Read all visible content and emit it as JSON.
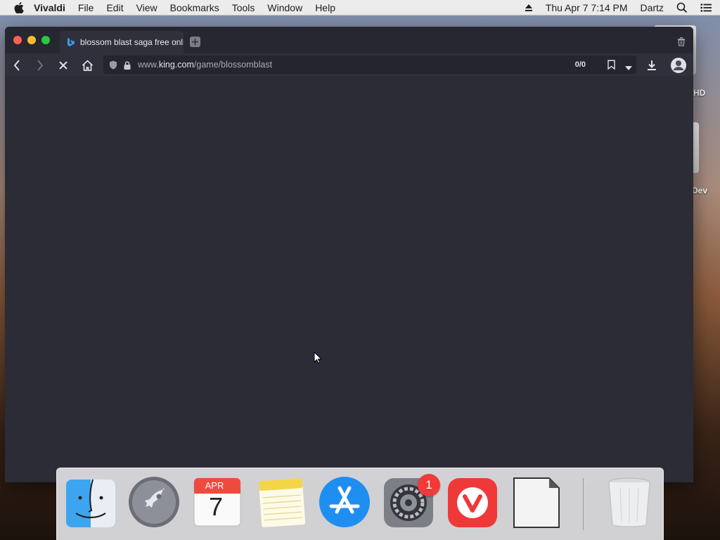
{
  "menubar": {
    "app_name": "Vivaldi",
    "menus": [
      "File",
      "Edit",
      "View",
      "Bookmarks",
      "Tools",
      "Window",
      "Help"
    ],
    "datetime": "Thu Apr 7  7:14 PM",
    "user": "Dartz"
  },
  "desktop": {
    "disk_label": "HD",
    "dev_label": "Dev"
  },
  "browser": {
    "tab_title": "blossom blast saga free online",
    "url_prefix": "www.",
    "url_host": "king.com",
    "url_path": "/game/blossomblast",
    "find_counter": "0/0"
  },
  "dock": {
    "calendar_month": "APR",
    "calendar_day": "7",
    "system_prefs_badge": "1"
  },
  "colors": {
    "window_bg": "#2b2c36",
    "toolbar_bg": "#2f303b",
    "badge_red": "#f23a3a"
  }
}
